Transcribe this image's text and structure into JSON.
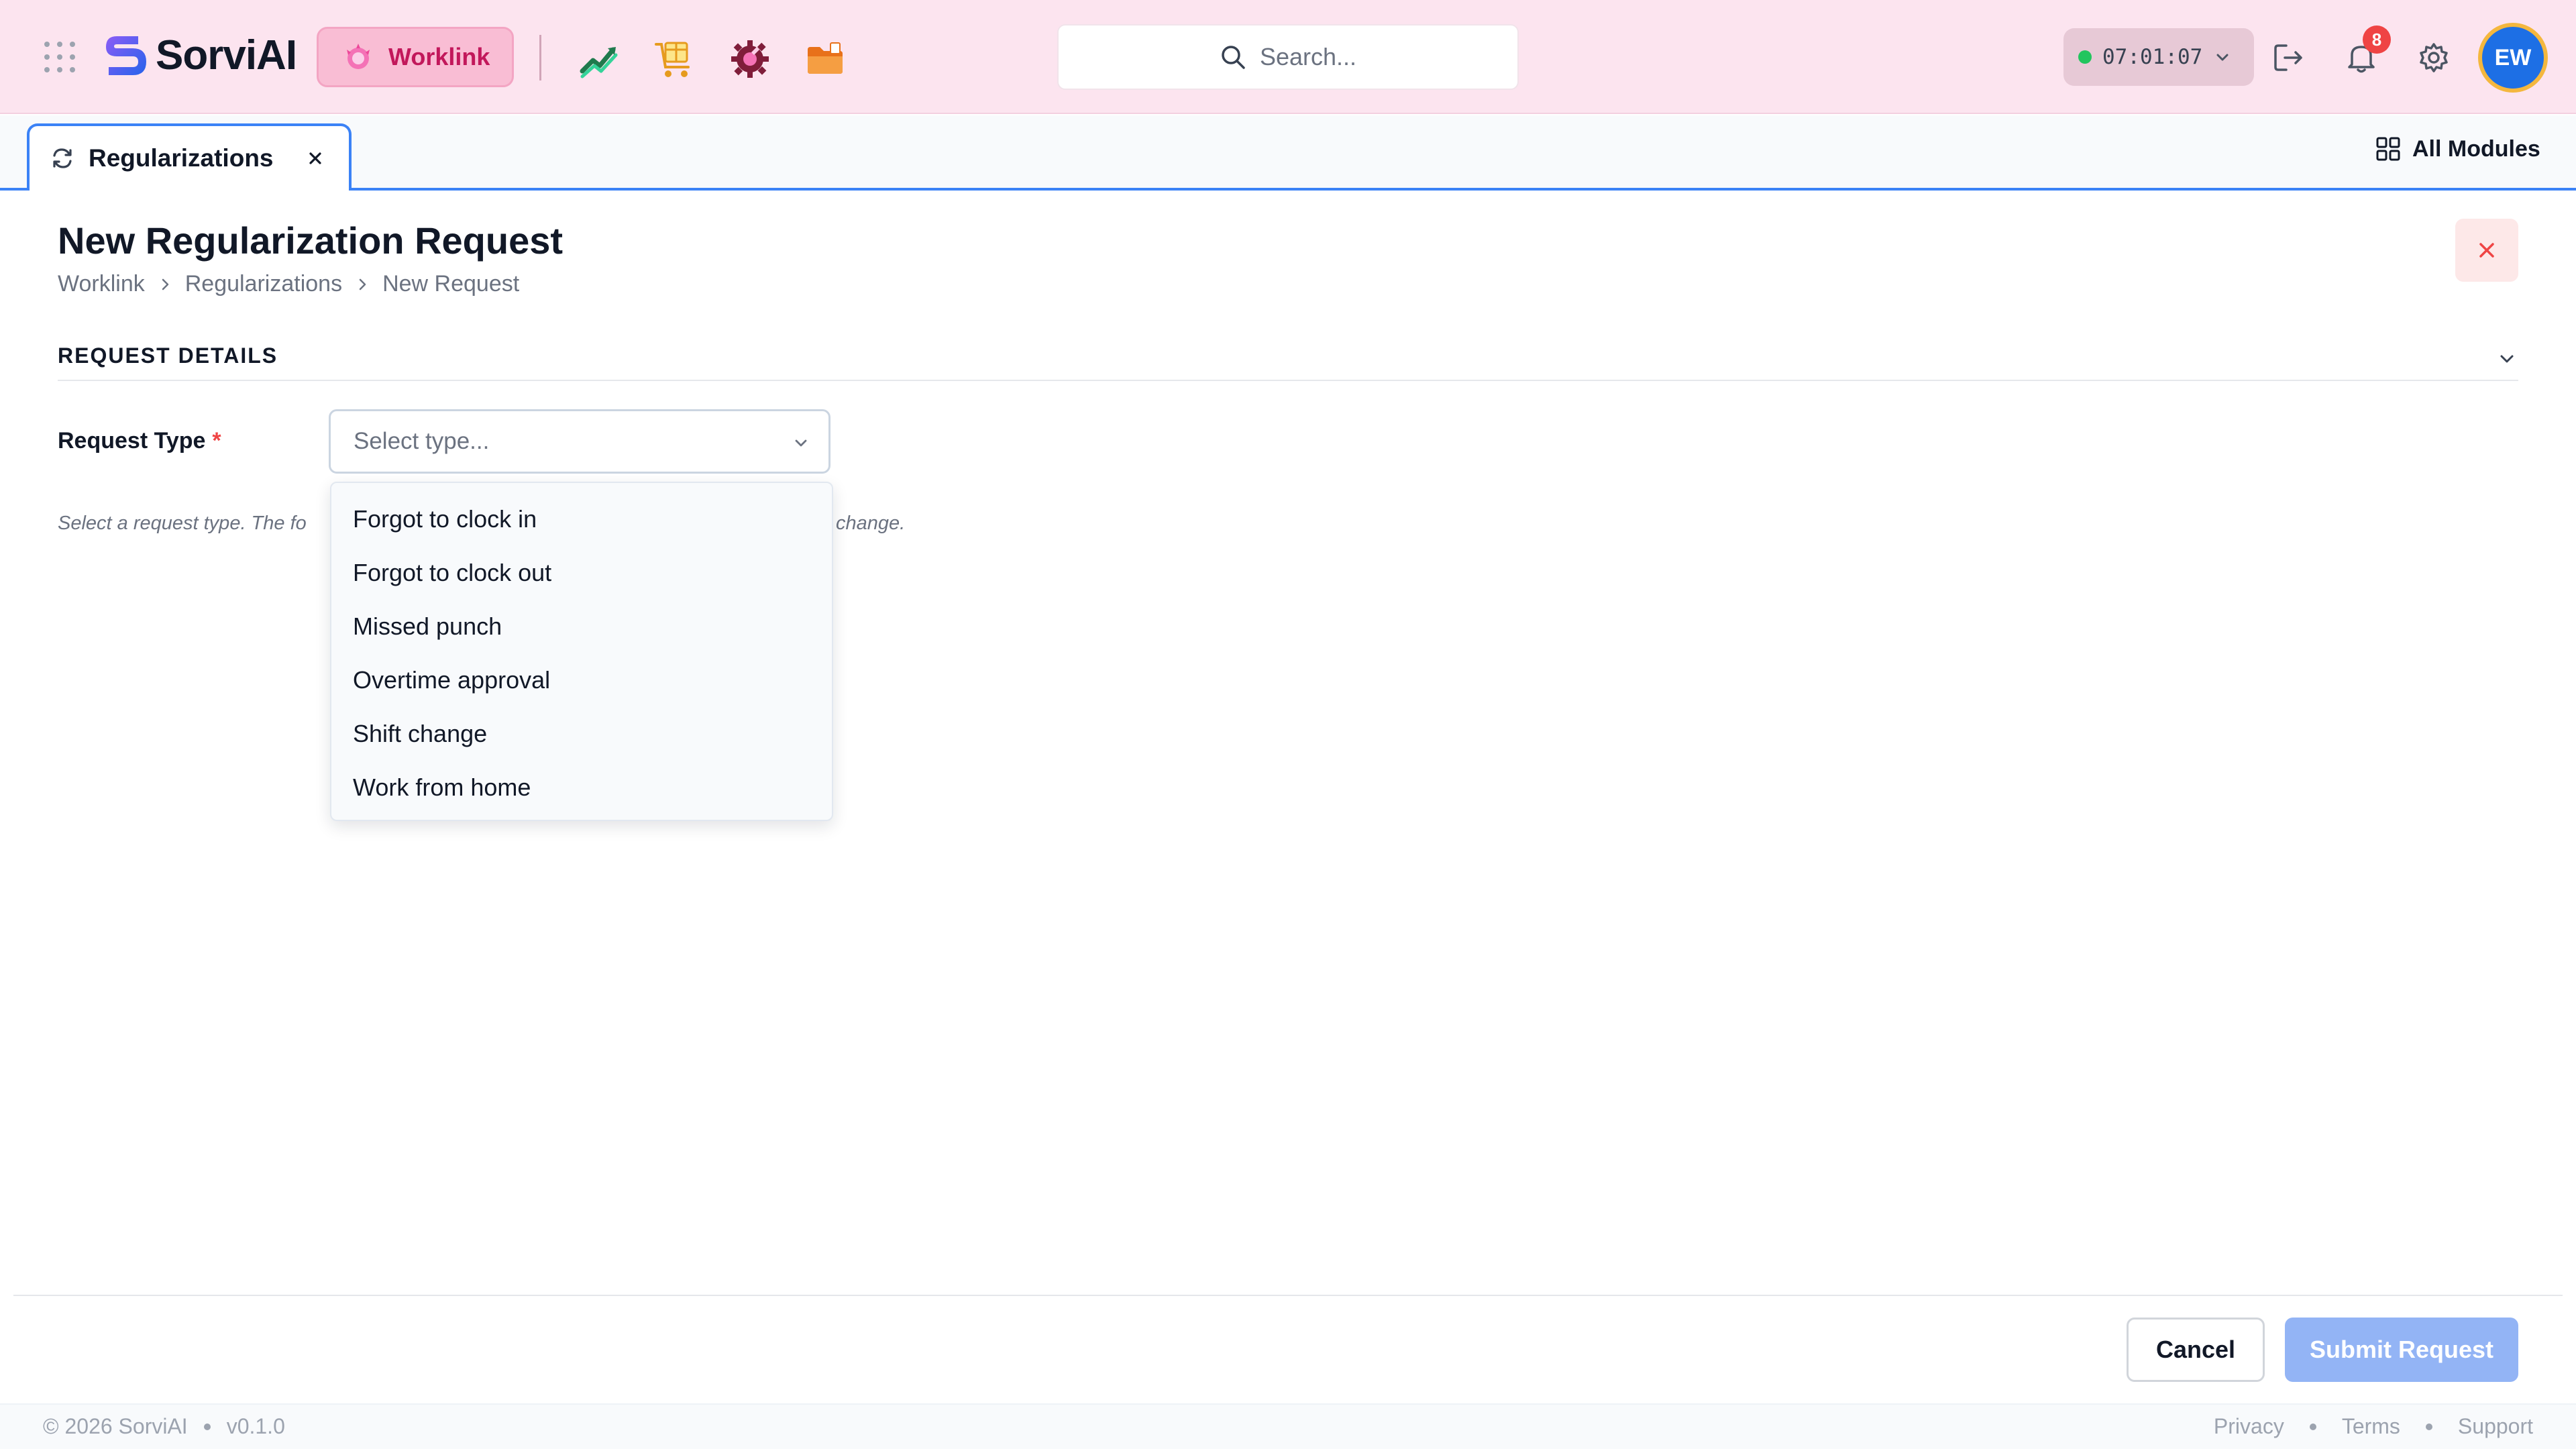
{
  "app": {
    "name": "SorviAI",
    "module": "Worklink",
    "search_placeholder": "Search...",
    "timer": "07:01:07",
    "notification_count": "8",
    "user_initials": "EW"
  },
  "tabs": {
    "active": "Regularizations",
    "all_modules": "All Modules"
  },
  "page": {
    "title": "New Regularization Request",
    "breadcrumb": [
      "Worklink",
      "Regularizations",
      "New Request"
    ]
  },
  "section": {
    "title": "REQUEST DETAILS"
  },
  "form": {
    "request_type_label": "Request Type",
    "required_mark": "*",
    "select_placeholder": "Select type...",
    "hint_visible": "Select a request type. The fo",
    "hint_tail": "change.",
    "options": [
      "Forgot to clock in",
      "Forgot to clock out",
      "Missed punch",
      "Overtime approval",
      "Shift change",
      "Work from home"
    ]
  },
  "actions": {
    "cancel": "Cancel",
    "submit": "Submit Request"
  },
  "footer": {
    "copyright": "© 2026 SorviAI",
    "version": "v0.1.0",
    "links": [
      "Privacy",
      "Terms",
      "Support"
    ]
  },
  "colors": {
    "topbar_bg": "#fce4ef",
    "accent": "#3b82f6",
    "module_pill": "#f9bdd4",
    "status_online": "#22c55e",
    "badge": "#ef4444",
    "submit_disabled": "#93b4f5"
  }
}
